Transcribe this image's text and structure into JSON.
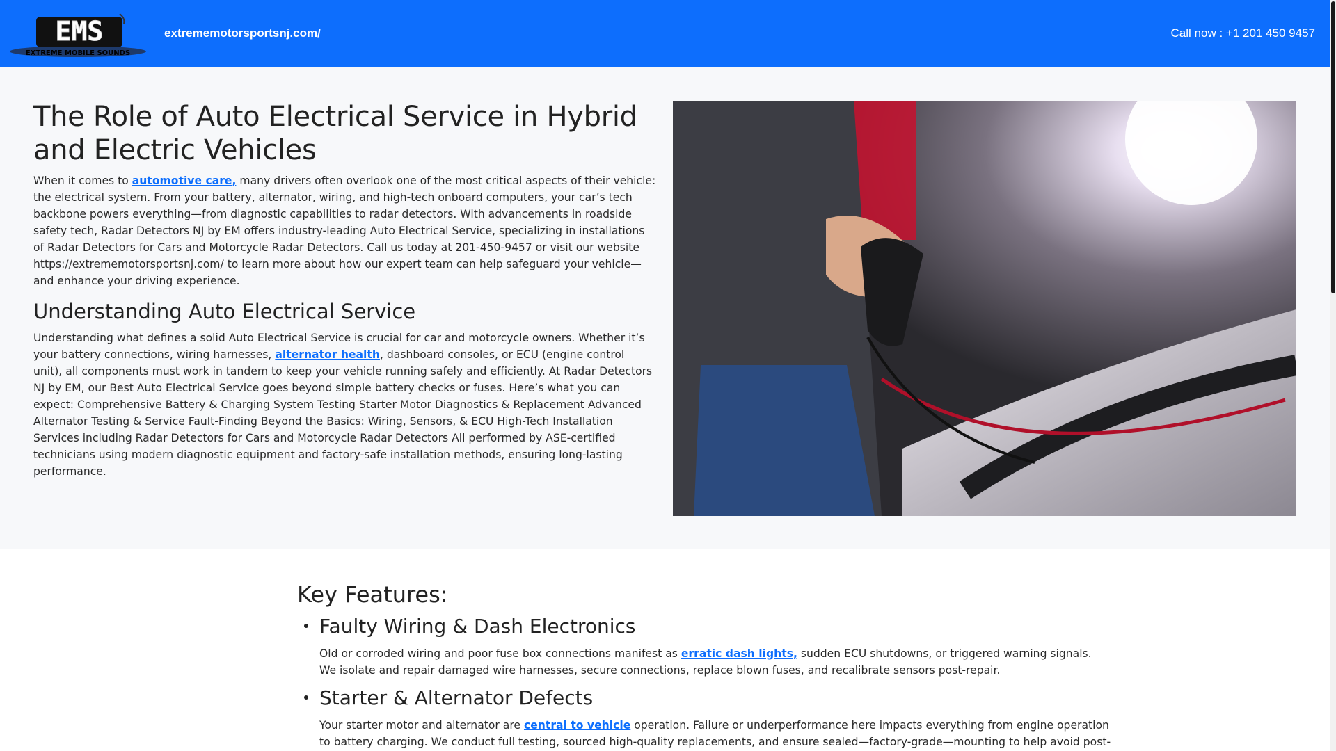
{
  "header": {
    "logo_text": "EMS",
    "logo_subtext": "EXTREME MOBILE SOUNDS",
    "site_url": "extrememotorsportsnj.com/",
    "call_now": "Call now : +1 201 450 9457",
    "bg_color": "#0d6efd"
  },
  "hero": {
    "title": "The Role of Auto Electrical Service in Hybrid and Electric Vehicles",
    "intro_before_link": "When it comes to ",
    "intro_link": "automotive care,",
    "intro_after_link": " many drivers often overlook one of the most critical aspects of their vehicle: the electrical system. From your battery, alternator, wiring, and high-tech onboard computers, your car’s tech backbone powers everything—from diagnostic capabilities to radar detectors. With advancements in roadside safety tech, Radar Detectors NJ by EM offers industry-leading Auto Electrical Service, specializing in installations of Radar Detectors for Cars and Motorcycle Radar Detectors. Call us today at 201-450-9457 or visit our website https://extrememotorsportsnj.com/ to learn more about how our expert team can help safeguard your vehicle—and enhance your driving experience.",
    "subheading": "Understanding Auto Electrical Service",
    "body_before_link": "Understanding what defines a solid Auto Electrical Service is crucial for car and motorcycle owners. Whether it’s your battery connections, wiring harnesses, ",
    "body_link": "alternator health",
    "body_after_link": ", dashboard consoles, or ECU (engine control unit), all components must work in tandem to keep your vehicle running safely and efficiently. At Radar Detectors NJ by EM, our Best Auto Electrical Service goes beyond simple battery checks or fuses. Here’s what you can expect: Comprehensive Battery & Charging System Testing Starter Motor Diagnostics & Replacement Advanced Alternator Testing & Service Fault-Finding Beyond the Basics: Wiring, Sensors, & ECU High-Tech Installation Services including Radar Detectors for Cars and Motorcycle Radar Detectors All performed by ASE-certified technicians using modern diagnostic equipment and factory-safe installation methods, ensuring long-lasting performance."
  },
  "features": {
    "heading": "Key Features:",
    "items": [
      {
        "title": "Faulty Wiring & Dash Electronics",
        "text_before_link": "Old or corroded wiring and poor fuse box connections manifest as ",
        "link": "erratic dash lights,",
        "text_after_link": " sudden ECU shutdowns, or triggered warning signals. We isolate and repair damaged wire harnesses, secure connections, replace blown fuses, and recalibrate sensors post-repair."
      },
      {
        "title": "Starter & Alternator Defects",
        "text_before_link": "Your starter motor and alternator are ",
        "link": "central to vehicle",
        "text_after_link": " operation. Failure or underperformance here impacts everything from engine operation to battery charging. We conduct full testing, sourced high-quality replacements, and ensure sealed—factory-grade—mounting to help avoid post-repair"
      }
    ]
  }
}
